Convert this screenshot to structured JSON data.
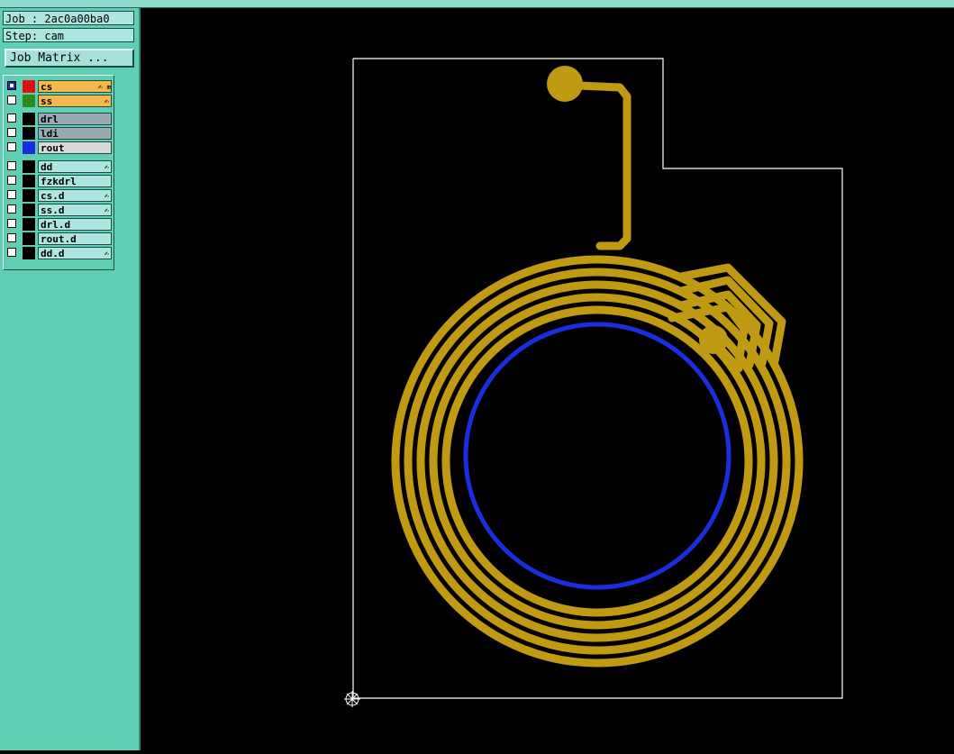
{
  "header": {
    "job_label": "Job : 2ac0a00ba0",
    "step_label": "Step: cam",
    "matrix_button": "Job Matrix ..."
  },
  "layers": [
    {
      "name": "cs",
      "checked": true,
      "color": "#e01010",
      "bg": "#f5b84a",
      "icon": "hand",
      "extra": true
    },
    {
      "name": "ss",
      "checked": false,
      "color": "#2e8c1e",
      "bg": "#f5b84a",
      "icon": "hand",
      "extra": false
    },
    {
      "name": "drl",
      "checked": false,
      "color": "#000000",
      "bg": "#9aa8b0",
      "icon": "",
      "extra": false
    },
    {
      "name": "ldi",
      "checked": false,
      "color": "#000000",
      "bg": "#9aa8b0",
      "icon": "",
      "extra": false
    },
    {
      "name": "rout",
      "checked": false,
      "color": "#1a2ee0",
      "bg": "#d9d9d9",
      "icon": "",
      "extra": false
    },
    {
      "name": "dd",
      "checked": false,
      "color": "#000000",
      "bg": "#aee6df",
      "icon": "hand",
      "extra": false
    },
    {
      "name": "fzkdrl",
      "checked": false,
      "color": "#000000",
      "bg": "#aee6df",
      "icon": "",
      "extra": false
    },
    {
      "name": "cs.d",
      "checked": false,
      "color": "#000000",
      "bg": "#aee6df",
      "icon": "hand",
      "extra": false
    },
    {
      "name": "ss.d",
      "checked": false,
      "color": "#000000",
      "bg": "#aee6df",
      "icon": "hand",
      "extra": false
    },
    {
      "name": "drl.d",
      "checked": false,
      "color": "#000000",
      "bg": "#aee6df",
      "icon": "",
      "extra": false
    },
    {
      "name": "rout.d",
      "checked": false,
      "color": "#000000",
      "bg": "#aee6df",
      "icon": "",
      "extra": false
    },
    {
      "name": "dd.d",
      "checked": false,
      "color": "#000000",
      "bg": "#aee6df",
      "icon": "hand",
      "extra": false
    }
  ],
  "colors": {
    "sidebar": "#5fcfb3",
    "trace": "#c09a12",
    "rout": "#1a2ee0",
    "outline": "#ffffff",
    "canvas": "#000000"
  },
  "icons": {
    "hand": "✍",
    "extra": "⊞",
    "origin": "datum-origin-icon"
  }
}
